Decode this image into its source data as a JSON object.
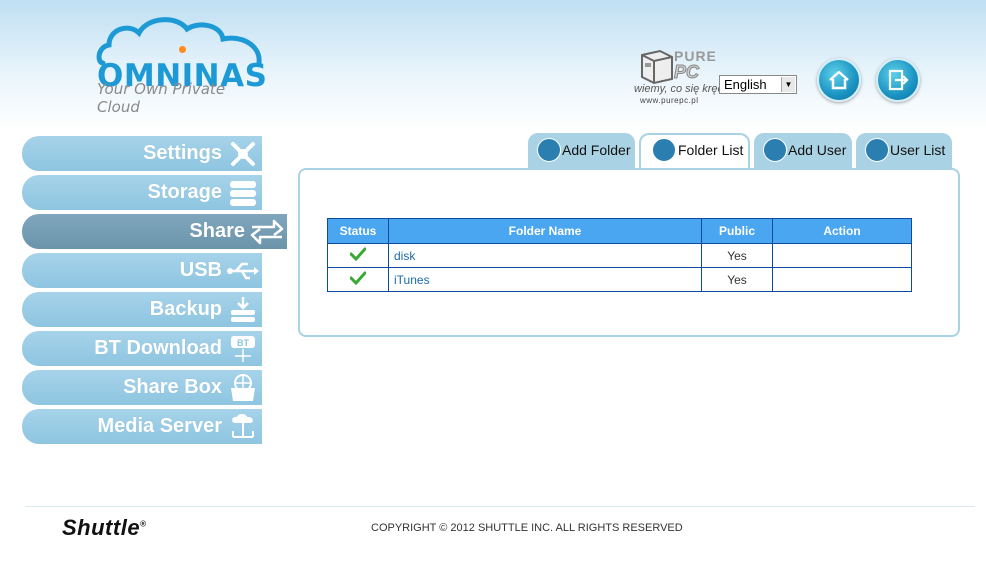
{
  "header": {
    "logo_name": "OMNINAS",
    "logo_tagline": "Your Own Private Cloud",
    "watermark": {
      "line1": "PURE",
      "line2": "PC",
      "tagline": "wiemy, co się kręci",
      "url": "www.purepc.pl"
    },
    "language_selected": "English",
    "home_icon": "home-icon",
    "logout_icon": "logout-icon"
  },
  "sidebar": {
    "items": [
      {
        "label": "Settings",
        "icon": "tools-icon",
        "active": false
      },
      {
        "label": "Storage",
        "icon": "storage-icon",
        "active": false
      },
      {
        "label": "Share",
        "icon": "share-arrows-icon",
        "active": true
      },
      {
        "label": "USB",
        "icon": "usb-icon",
        "active": false
      },
      {
        "label": "Backup",
        "icon": "backup-icon",
        "active": false
      },
      {
        "label": "BT Download",
        "icon": "bt-download-icon",
        "active": false
      },
      {
        "label": "Share Box",
        "icon": "share-box-icon",
        "active": false
      },
      {
        "label": "Media Server",
        "icon": "media-server-icon",
        "active": false
      }
    ]
  },
  "tabs": [
    {
      "label": "Add Folder",
      "icon": "add-folder-icon",
      "active": false
    },
    {
      "label": "Folder List",
      "icon": "folder-list-icon",
      "active": true
    },
    {
      "label": "Add User",
      "icon": "add-user-icon",
      "active": false
    },
    {
      "label": "User List",
      "icon": "user-list-icon",
      "active": false
    }
  ],
  "table": {
    "columns": [
      "Status",
      "Folder Name",
      "Public",
      "Action"
    ],
    "rows": [
      {
        "status": "ok",
        "folder": "disk",
        "public": "Yes",
        "action": ""
      },
      {
        "status": "ok",
        "folder": "iTunes",
        "public": "Yes",
        "action": ""
      }
    ]
  },
  "footer": {
    "brand": "Shuttle",
    "copyright": "COPYRIGHT © 2012 SHUTTLE INC. ALL RIGHTS RESERVED"
  },
  "colors": {
    "accent": "#1d9ad6",
    "sidebar": "#9ccde5",
    "sidebar_active": "#7aa1b8",
    "table_header": "#4aa6f0",
    "table_border": "#0b4d9c"
  }
}
